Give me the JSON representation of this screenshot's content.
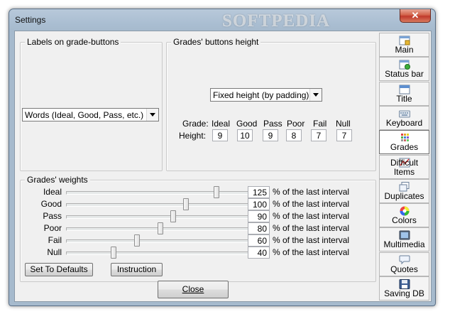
{
  "window": {
    "title": "Settings",
    "watermark": "SOFTPEDIA",
    "close_glyph": "✕"
  },
  "labels_group": {
    "legend": "Labels on grade-buttons",
    "select_value": "Words (Ideal, Good, Pass, etc.)"
  },
  "height_group": {
    "legend": "Grades' buttons height",
    "select_value": "Fixed height (by padding)",
    "row_grade_label": "Grade:",
    "row_height_label": "Height:",
    "grades": [
      {
        "name": "Ideal",
        "height": "9"
      },
      {
        "name": "Good",
        "height": "10"
      },
      {
        "name": "Pass",
        "height": "9"
      },
      {
        "name": "Poor",
        "height": "8"
      },
      {
        "name": "Fail",
        "height": "7"
      },
      {
        "name": "Null",
        "height": "7"
      }
    ]
  },
  "weights_group": {
    "legend": "Grades' weights",
    "suffix": "% of the last interval",
    "rows": [
      {
        "name": "Ideal",
        "value": "125",
        "level": 0.83
      },
      {
        "name": "Good",
        "value": "100",
        "level": 0.66
      },
      {
        "name": "Pass",
        "value": "90",
        "level": 0.59
      },
      {
        "name": "Poor",
        "value": "80",
        "level": 0.52
      },
      {
        "name": "Fail",
        "value": "60",
        "level": 0.39
      },
      {
        "name": "Null",
        "value": "40",
        "level": 0.26
      }
    ],
    "defaults_button": "Set To Defaults",
    "instruction_button": "Instruction"
  },
  "close_button": "Close",
  "tabs": [
    {
      "label": "Main",
      "icon": "main-settings-icon",
      "active": false
    },
    {
      "label": "Status bar",
      "icon": "status-bar-icon",
      "active": false
    },
    {
      "label": "Title",
      "icon": "title-window-icon",
      "active": false
    },
    {
      "label": "Keyboard",
      "icon": "keyboard-icon",
      "active": false
    },
    {
      "label": "Grades",
      "icon": "grades-grid-icon",
      "active": true
    },
    {
      "label": "Difficult Items",
      "icon": "difficult-items-icon",
      "active": false
    },
    {
      "label": "Duplicates",
      "icon": "duplicates-icon",
      "active": false
    },
    {
      "label": "Colors",
      "icon": "color-wheel-icon",
      "active": false
    },
    {
      "label": "Multimedia",
      "icon": "multimedia-icon",
      "active": false
    },
    {
      "label": "Quotes",
      "icon": "speech-bubble-icon",
      "active": false
    },
    {
      "label": "Saving DB",
      "icon": "floppy-disk-icon",
      "active": false
    }
  ]
}
